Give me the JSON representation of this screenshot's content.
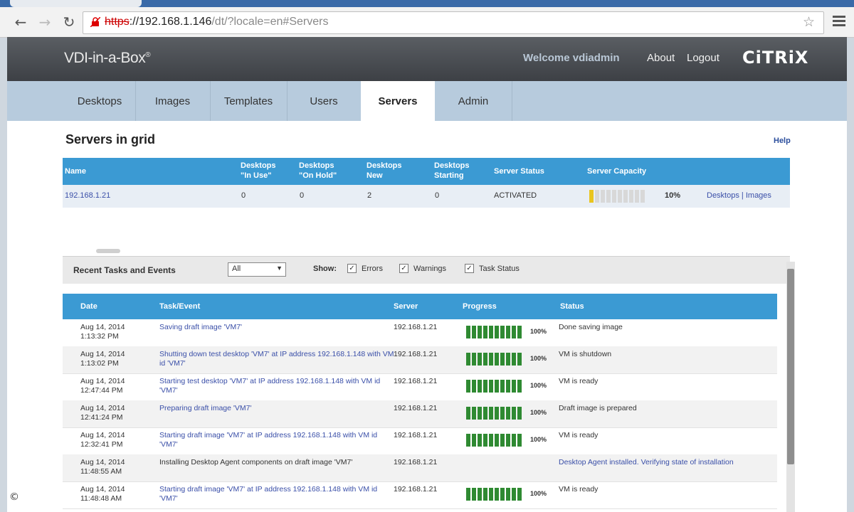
{
  "browser": {
    "url_protocol": "https",
    "url_host": "://192.168.1.146",
    "url_path": "/dt/?locale=en#Servers"
  },
  "header": {
    "brand": "VDI-in-a-Box",
    "brand_mark": "®",
    "welcome": "Welcome vdiadmin",
    "about": "About",
    "logout": "Logout",
    "vendor_logo": "CiTRiX"
  },
  "nav": {
    "tabs": [
      "Desktops",
      "Images",
      "Templates",
      "Users",
      "Servers",
      "Admin"
    ],
    "active": "Servers"
  },
  "servers": {
    "title": "Servers in grid",
    "help": "Help",
    "columns": {
      "name": "Name",
      "in_use": [
        "Desktops",
        "\"In Use\""
      ],
      "on_hold": [
        "Desktops",
        "\"On Hold\""
      ],
      "new": [
        "Desktops",
        "New"
      ],
      "starting": [
        "Desktops",
        "Starting"
      ],
      "status": "Server Status",
      "capacity": "Server Capacity"
    },
    "rows": [
      {
        "name": "192.168.1.21",
        "in_use": "0",
        "on_hold": "0",
        "new": "2",
        "starting": "0",
        "status": "ACTIVATED",
        "capacity_fraction": 0.1,
        "capacity_label": "10%",
        "link_desktops": "Desktops",
        "link_sep": "|",
        "link_images": "Images"
      }
    ]
  },
  "events": {
    "title": "Recent Tasks and Events",
    "filter_value": "All",
    "show_label": "Show:",
    "checkboxes": [
      {
        "label": "Errors",
        "checked": true
      },
      {
        "label": "Warnings",
        "checked": true
      },
      {
        "label": "Task Status",
        "checked": true
      }
    ],
    "columns": {
      "date": "Date",
      "task": "Task/Event",
      "server": "Server",
      "progress": "Progress",
      "status": "Status"
    },
    "rows": [
      {
        "date": "Aug 14, 2014",
        "time": "1:13:32 PM",
        "task": "Saving draft image 'VM7'",
        "server": "192.168.1.21",
        "progress": 1.0,
        "pct": "100%",
        "status": "Done saving image"
      },
      {
        "date": "Aug 14, 2014",
        "time": "1:13:02 PM",
        "task": "Shutting down test desktop 'VM7' at IP address 192.168.1.148 with VM id 'VM7'",
        "server": "192.168.1.21",
        "progress": 1.0,
        "pct": "100%",
        "status": "VM is shutdown"
      },
      {
        "date": "Aug 14, 2014",
        "time": "12:47:44 PM",
        "task": "Starting test desktop 'VM7' at IP address 192.168.1.148 with VM id 'VM7'",
        "server": "192.168.1.21",
        "progress": 1.0,
        "pct": "100%",
        "status": "VM is ready"
      },
      {
        "date": "Aug 14, 2014",
        "time": "12:41:24 PM",
        "task": "Preparing draft image 'VM7'",
        "server": "192.168.1.21",
        "progress": 1.0,
        "pct": "100%",
        "status": "Draft image is prepared"
      },
      {
        "date": "Aug 14, 2014",
        "time": "12:32:41 PM",
        "task": "Starting draft image 'VM7' at IP address 192.168.1.148 with VM id 'VM7'",
        "server": "192.168.1.21",
        "progress": 1.0,
        "pct": "100%",
        "status": "VM is ready"
      },
      {
        "date": "Aug 14, 2014",
        "time": "11:48:55 AM",
        "task": "Installing Desktop Agent components on draft image 'VM7'",
        "server": "192.168.1.21",
        "progress": null,
        "pct": "",
        "status": "Desktop Agent installed. Verifying state of installation"
      },
      {
        "date": "Aug 14, 2014",
        "time": "11:48:48 AM",
        "task": "Starting draft image 'VM7' at IP address 192.168.1.148 with VM id 'VM7'",
        "server": "192.168.1.21",
        "progress": 1.0,
        "pct": "100%",
        "status": "VM is ready"
      }
    ]
  },
  "copyright": "©"
}
